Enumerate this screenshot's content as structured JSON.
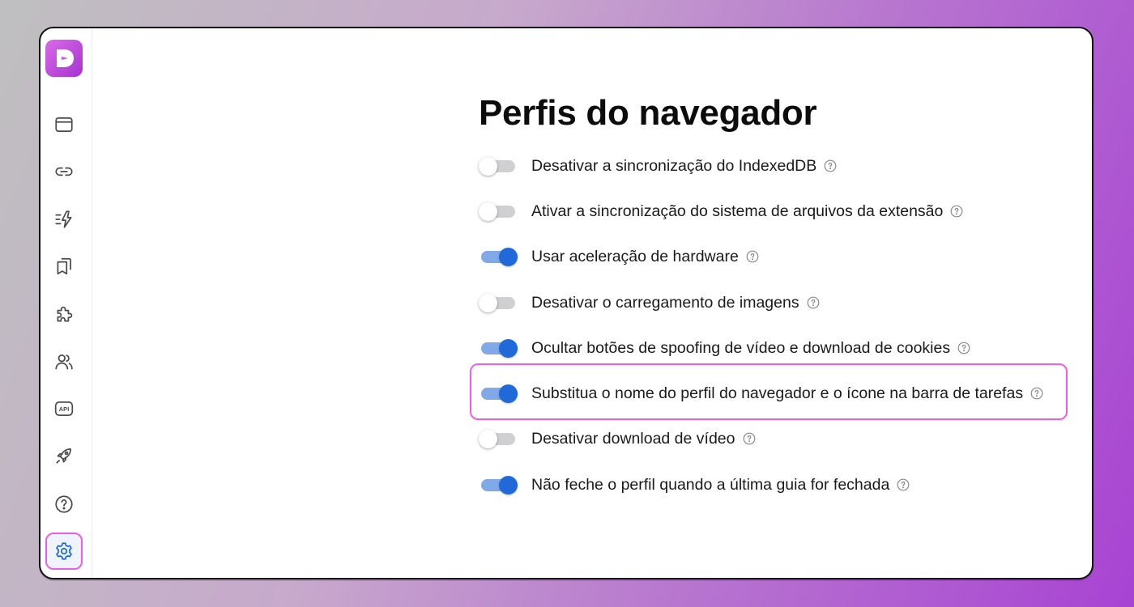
{
  "app": {
    "logo_letter": "D",
    "logo_color": "#b440d6",
    "accent_color": "#1f6ad8",
    "highlight_color": "#ec5de9"
  },
  "sidebar": {
    "items": [
      {
        "icon": "browser-window-icon",
        "active": false
      },
      {
        "icon": "link-icon",
        "active": false
      },
      {
        "icon": "automation-icon",
        "active": false
      },
      {
        "icon": "bookmarks-icon",
        "active": false
      },
      {
        "icon": "extensions-icon",
        "active": false
      },
      {
        "icon": "users-icon",
        "active": false
      },
      {
        "icon": "api-icon",
        "label": "API",
        "active": false
      },
      {
        "icon": "rocket-icon",
        "active": false
      },
      {
        "icon": "help-icon",
        "active": false
      },
      {
        "icon": "gear-icon",
        "active": true
      }
    ]
  },
  "main": {
    "title": "Perfis do navegador",
    "settings": [
      {
        "label": "Desativar a sincronização do IndexedDB",
        "enabled": false
      },
      {
        "label": "Ativar a sincronização do sistema de arquivos da extensão",
        "enabled": false
      },
      {
        "label": "Usar aceleração de hardware",
        "enabled": true
      },
      {
        "label": "Desativar o carregamento de imagens",
        "enabled": false
      },
      {
        "label": "Ocultar botões de spoofing de vídeo e download de cookies",
        "enabled": true
      },
      {
        "label": "Substitua o nome do perfil do navegador e o ícone na barra de tarefas",
        "enabled": true,
        "highlighted": true
      },
      {
        "label": "Desativar download de vídeo",
        "enabled": false
      },
      {
        "label": "Não feche o perfil quando a última guia for fechada",
        "enabled": true
      }
    ]
  }
}
